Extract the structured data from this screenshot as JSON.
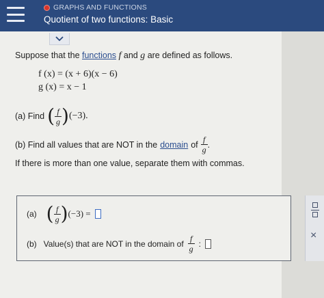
{
  "header": {
    "topic": "GRAPHS AND FUNCTIONS",
    "title": "Quotient of two functions: Basic"
  },
  "intro": {
    "prefix": "Suppose that the ",
    "link": "functions",
    "f": "f",
    "middle": " and ",
    "g": "g",
    "suffix": " are defined as follows."
  },
  "equations": {
    "f": "f (x) = (x + 6)(x − 6)",
    "g": "g (x) = x − 1"
  },
  "part_a": {
    "label": "(a) Find",
    "num": "f",
    "den": "g",
    "arg": "(−3)."
  },
  "part_b": {
    "label": "(b) Find all values that are NOT in the",
    "link": "domain",
    "of": "of",
    "num": "f",
    "den": "g",
    "period": "."
  },
  "instruction": "If there is more than one value, separate them with commas.",
  "answers": {
    "a_label": "(a)",
    "a_num": "f",
    "a_den": "g",
    "a_expr": "(−3) =",
    "b_label": "(b)",
    "b_text": "Value(s) that are NOT in the domain of",
    "b_num": "f",
    "b_den": "g",
    "b_colon": ":"
  },
  "toolbar": {
    "clear": "×"
  }
}
